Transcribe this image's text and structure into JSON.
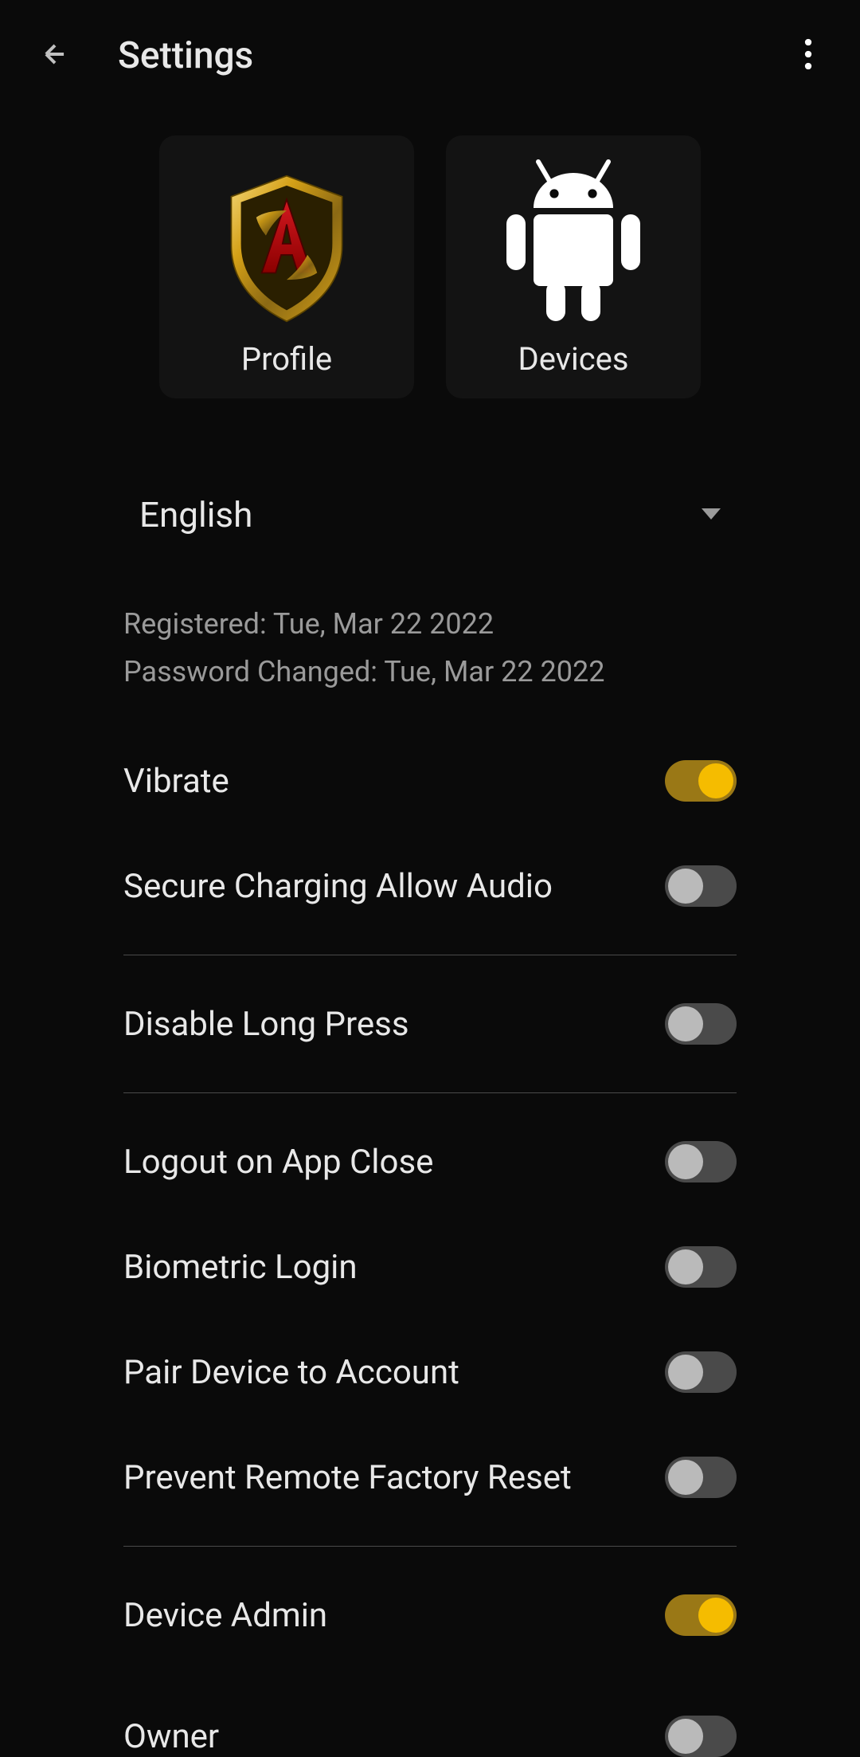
{
  "header": {
    "title": "Settings"
  },
  "cards": {
    "profile": {
      "label": "Profile"
    },
    "devices": {
      "label": "Devices"
    }
  },
  "language": {
    "selected": "English"
  },
  "info": {
    "registered_label": "Registered:",
    "registered_date": "Tue, Mar 22 2022",
    "password_changed_label": "Password Changed:",
    "password_changed_date": "Tue, Mar 22 2022"
  },
  "toggles": {
    "vibrate": {
      "label": "Vibrate",
      "value": true
    },
    "secure_charging": {
      "label": "Secure Charging Allow Audio",
      "value": false
    },
    "disable_long_press": {
      "label": "Disable Long Press",
      "value": false
    },
    "logout_on_close": {
      "label": "Logout on App Close",
      "value": false
    },
    "biometric_login": {
      "label": "Biometric Login",
      "value": false
    },
    "pair_device": {
      "label": "Pair Device to Account",
      "value": false
    },
    "prevent_remote_reset": {
      "label": "Prevent Remote Factory Reset",
      "value": false
    },
    "device_admin": {
      "label": "Device Admin",
      "value": true
    },
    "owner": {
      "label": "Owner",
      "value": false
    }
  }
}
